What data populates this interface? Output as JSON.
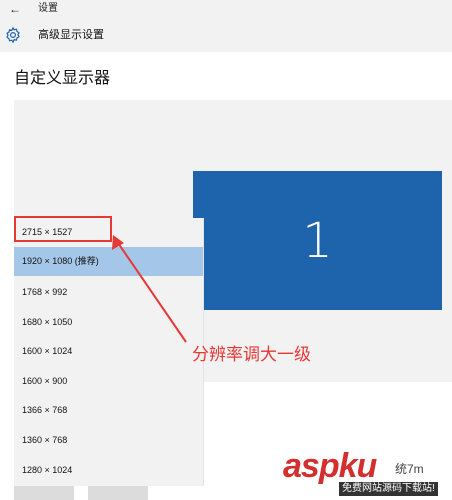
{
  "window": {
    "title": "设置",
    "back_glyph": "←"
  },
  "header": {
    "title": "高级显示设置",
    "icon": "gear-icon"
  },
  "page": {
    "heading": "自定义显示器"
  },
  "monitor": {
    "label": "1",
    "color": "#1d64ad"
  },
  "resolution_options": [
    {
      "label": "2715 × 1527"
    },
    {
      "label": "1920 × 1080 (推荐)",
      "selected": true
    },
    {
      "label": "1768 × 992"
    },
    {
      "label": "1680 × 1050"
    },
    {
      "label": "1600 × 1024"
    },
    {
      "label": "1600 × 900"
    },
    {
      "label": "1366 × 768"
    },
    {
      "label": "1360 × 768"
    },
    {
      "label": "1280 × 1024"
    }
  ],
  "annotation": {
    "text": "分辨率调大一级",
    "color": "#e53935"
  },
  "watermark": {
    "main": "aspku",
    "tail": "统7m",
    "sub": "免费网站源码下载站!"
  }
}
